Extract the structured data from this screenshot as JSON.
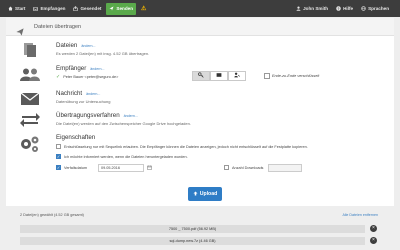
{
  "nav": {
    "left": [
      {
        "label": "Start",
        "icon": "home-icon"
      },
      {
        "label": "Empfangen",
        "icon": "inbox-icon"
      },
      {
        "label": "Gesendet",
        "icon": "outbox-icon"
      },
      {
        "label": "Senden",
        "icon": "send-icon",
        "active": true
      }
    ],
    "warning_icon": "⚠",
    "right": [
      {
        "label": "John Smith",
        "icon": "user-icon"
      },
      {
        "label": "Hilfe",
        "icon": "help-icon"
      },
      {
        "label": "Sprachen",
        "icon": "globe-icon"
      }
    ]
  },
  "panel": {
    "title": "Dateien übertragen"
  },
  "sections": {
    "files": {
      "title": "Dateien",
      "edit": "ändern...",
      "sub": "Es werden 2 Datei(en) mit insg. 4.52 GB übertragen."
    },
    "recipients": {
      "title": "Empfänger",
      "edit": "ändern...",
      "recipient": "Peter Bauer <peter@seguro.de>",
      "e2e_label": "Ende-zu-Ende verschlüsselt"
    },
    "message": {
      "title": "Nachricht",
      "edit": "ändern...",
      "sub": "Datenübung zur Untersuchung"
    },
    "transfer": {
      "title": "Übertragungsverfahren",
      "edit": "ändern...",
      "sub": "Die Datei(en) werden auf den Zwischenspeicher Google Drive hochgeladen."
    },
    "properties": {
      "title": "Eigenschaften",
      "option1": "Entschlüsselung nur mit Sequelink erlauben. Die Empfänger können die Dateien anzeigen, jedoch nicht entschlüsselt auf die Festplatte kopieren.",
      "option1_checked": false,
      "option2": "Ich möchte informiert werden, wenn die Dateien heruntergeladen wurden.",
      "option2_checked": true,
      "expiry_label": "Verfallsdatum",
      "expiry_checked": true,
      "expiry_value": "09.05.2016",
      "downloads_label": "Anzahl Downloads",
      "downloads_checked": false,
      "downloads_value": ""
    }
  },
  "upload_label": "Upload",
  "files_list": {
    "summary": "2 Datei(en) gewählt (4.52 GB gesamt)",
    "remove_all": "Alle Dateien entfernen",
    "items": [
      {
        "name": "7500 _ 7500.pdf (56.92 MB)"
      },
      {
        "name": "sql-dump.new.7z (4.46 GB)"
      }
    ]
  },
  "colors": {
    "topbar": "#3d3d3d",
    "active_nav": "#5aa94b",
    "accent": "#2f7dc6",
    "warning": "#f0b400"
  }
}
